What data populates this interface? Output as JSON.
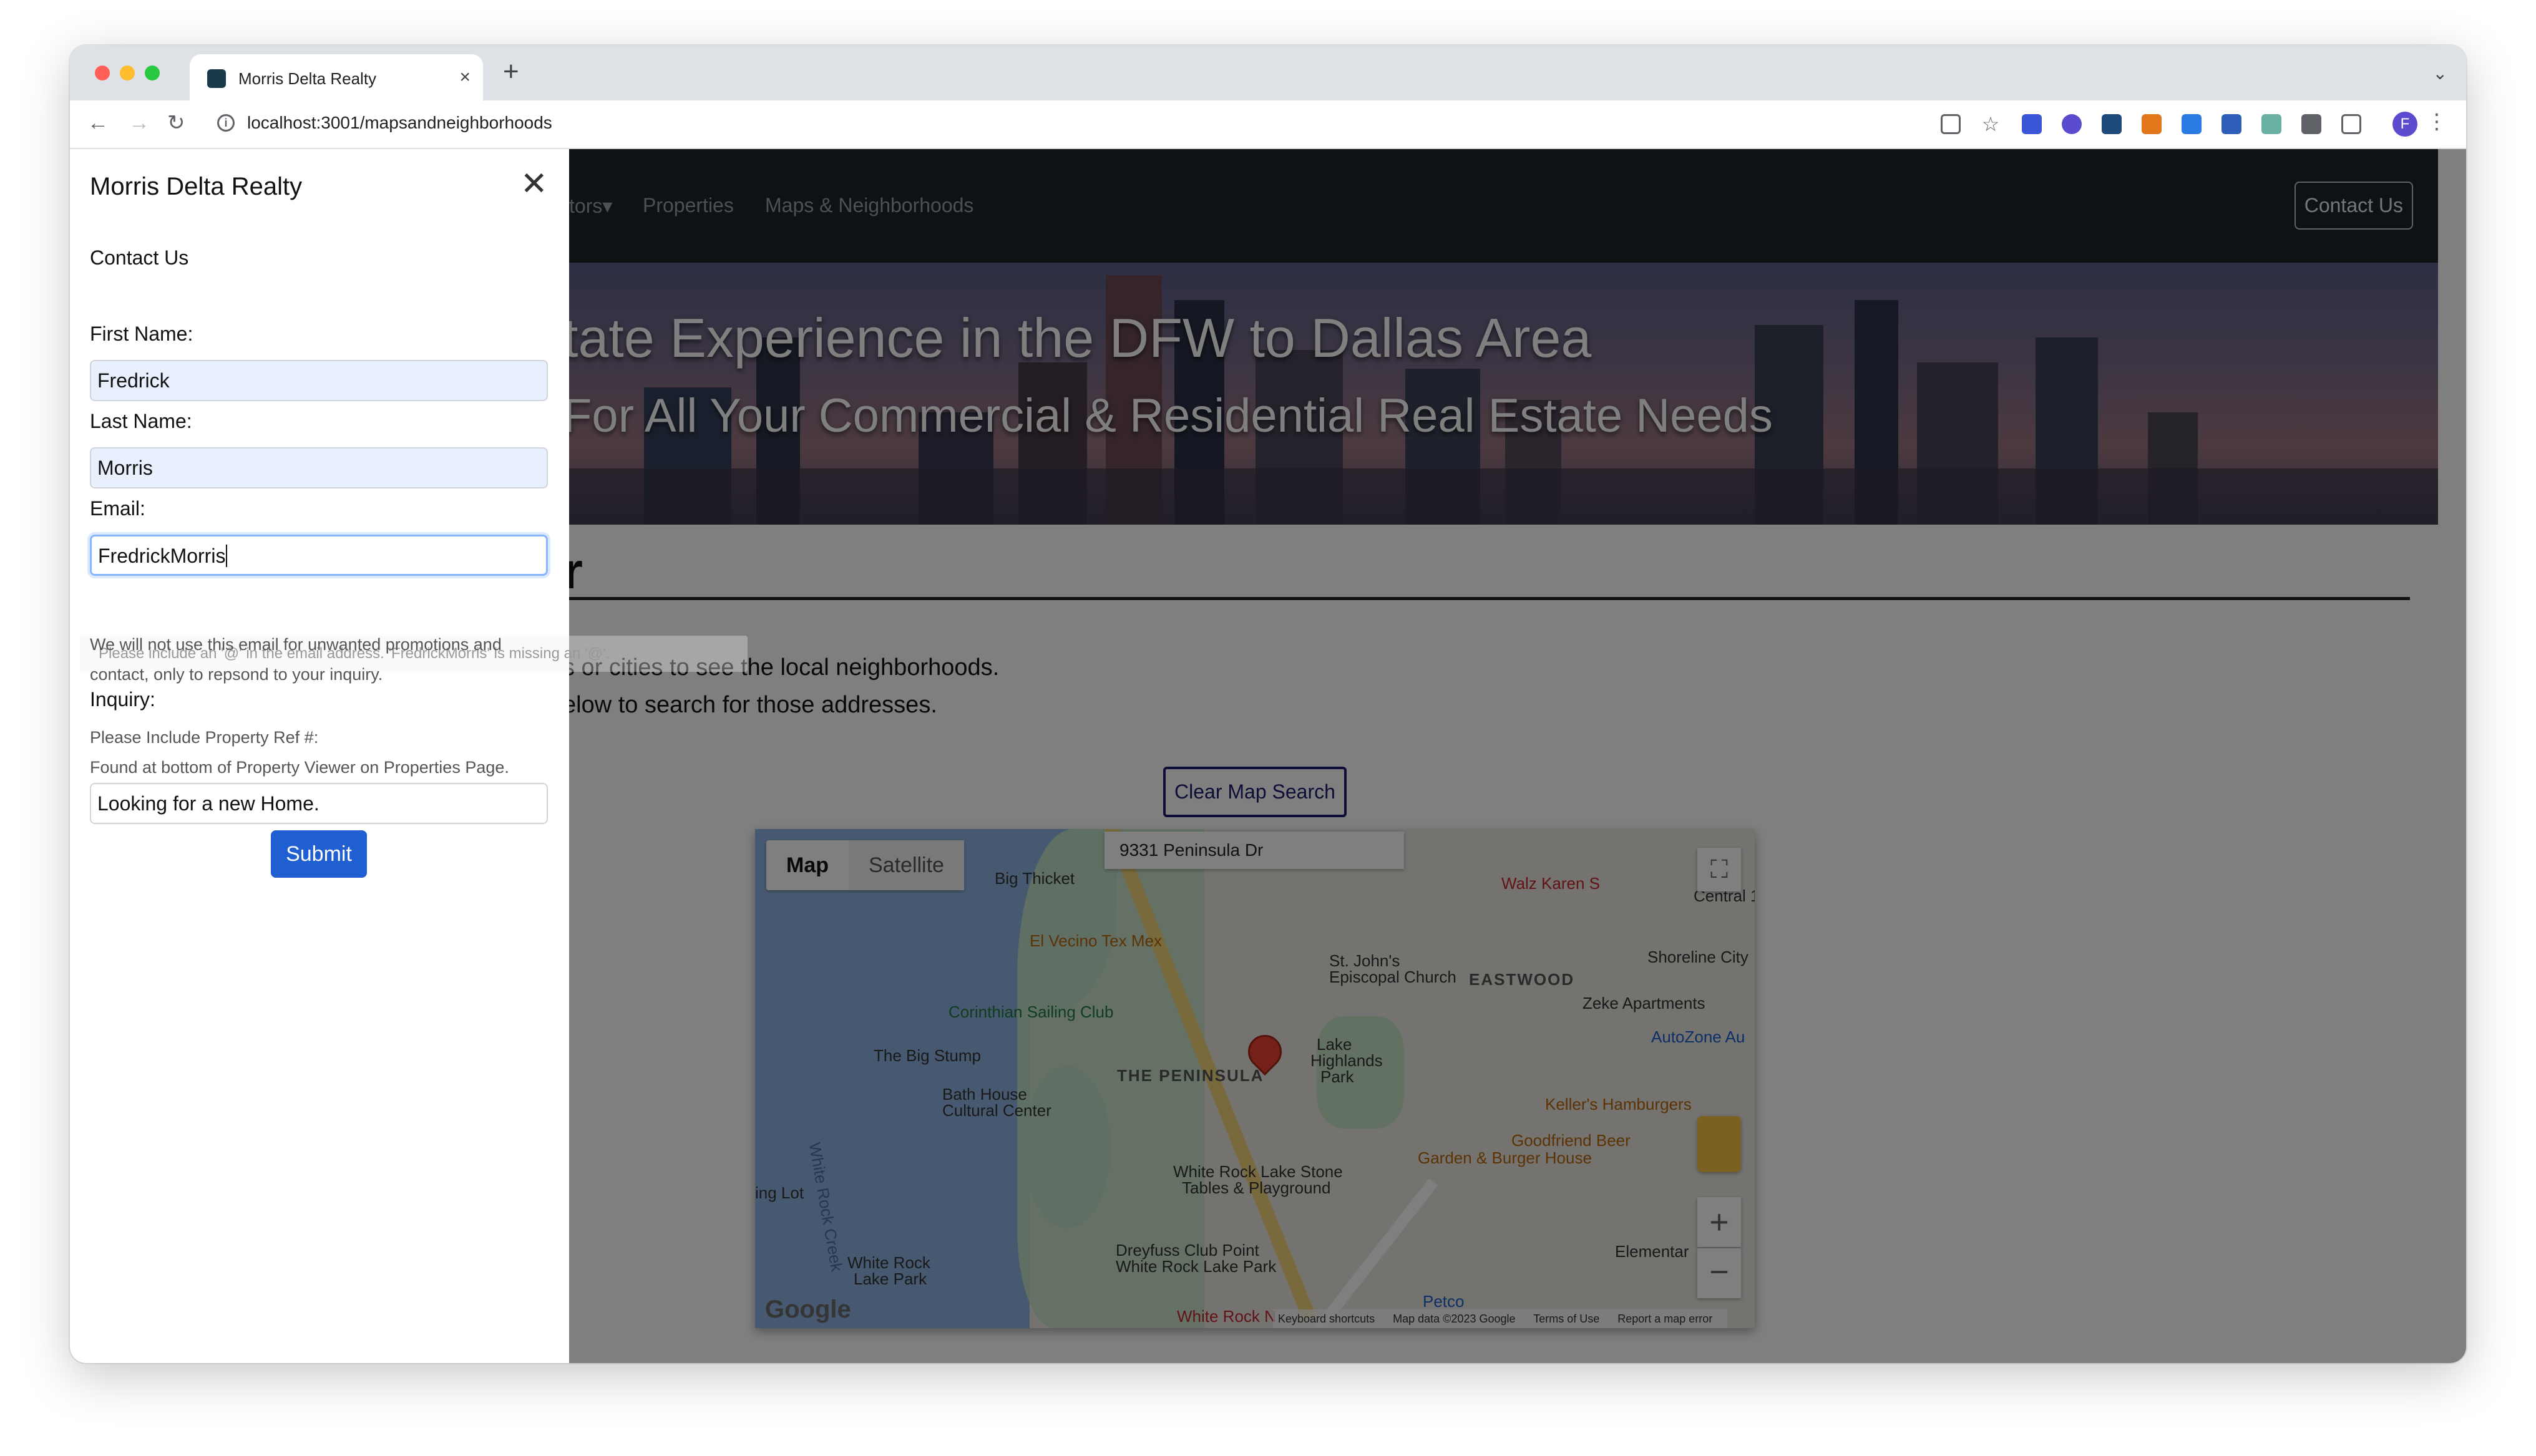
{
  "browser": {
    "tab_title": "Morris Delta Realty",
    "tab_close": "×",
    "new_tab": "+",
    "tab_dropdown": "⌄",
    "back": "←",
    "forward": "→",
    "reload": "↻",
    "url": "localhost:3001/mapsandneighborhoods",
    "profile_initial": "F",
    "menu": "⋮",
    "traffic_colors": [
      "#ff5f57",
      "#febc2e",
      "#28c840"
    ]
  },
  "navbar": {
    "items": [
      "tors",
      "Properties",
      "Maps & Neighborhoods"
    ],
    "caret": "▾",
    "contact": "Contact Us"
  },
  "hero": {
    "title": "tate Experience in the DFW to Dallas Area",
    "subtitle": "For All Your Commercial & Residential Real Estate Needs"
  },
  "main": {
    "heading_fragment": "r",
    "line1": "s or cities to see the local neighborhoods.",
    "line2": "elow to search for those addresses.",
    "clear_button": "Clear Map Search"
  },
  "map": {
    "type_map": "Map",
    "type_satellite": "Satellite",
    "search_value": "9331 Peninsula Dr",
    "labels": {
      "big_thicket": "Big Thicket",
      "el_vecino": "El Vecino Tex Mex",
      "corinthian": "Corinthian Sailing Club",
      "big_stump": "The Big Stump",
      "peninsula": "THE PENINSULA",
      "bath_house": "Bath House",
      "cultural_center": "Cultural Center",
      "st_johns": "St. John's",
      "episcopal": "Episcopal Church",
      "eastwood": "EASTWOOD",
      "walz": "Walz Karen S",
      "central": "Central 1",
      "shoreline": "Shoreline City",
      "zeke": "Zeke Apartments",
      "autozone": "AutoZone Au",
      "lake_highlands": "Lake",
      "lake_highlands2": "Highlands",
      "lake_highlands3": "Park",
      "kellers": "Keller's Hamburgers",
      "goodfriend": "Goodfriend Beer",
      "goodfriend2": "Garden & Burger House",
      "white_rock_stone": "White Rock Lake Stone",
      "white_rock_stone2": "Tables & Playground",
      "dreyfuss": "Dreyfuss Club Point",
      "dreyfuss2": "White Rock Lake Park",
      "white_rock_lake_park": "White Rock",
      "white_rock_lake_park2": "Lake Park",
      "white_rock_creek": "White Rock Creek",
      "elementary": "Elementar",
      "petco": "Petco",
      "lot": "ing Lot",
      "white_rock_bottom": "White Rock N"
    },
    "zoom_in": "+",
    "zoom_out": "−",
    "fullscreen": "⛶",
    "google": "Google",
    "footer": [
      "Keyboard shortcuts",
      "Map data ©2023 Google",
      "Terms of Use",
      "Report a map error"
    ]
  },
  "offcanvas": {
    "title": "Morris Delta Realty",
    "close": "✕",
    "heading": "Contact Us",
    "first_name_label": "First Name:",
    "first_name_value": "Fredrick",
    "last_name_label": "Last Name:",
    "last_name_value": "Morris",
    "email_label": "Email:",
    "email_value": "FredrickMorris",
    "email_help": "We will not use this email for unwanted promotions and contact, only to repsond to your inquiry.",
    "validation_tooltip": "Please include an '@' in the email address. 'FredrickMorris' is missing an '@'.",
    "inquiry_label": "Inquiry:",
    "ref_line1": "Please Include Property Ref #:",
    "ref_line2": "Found at bottom of Property Viewer on Properties Page.",
    "inquiry_value": "Looking for a new Home.",
    "submit": "Submit"
  }
}
